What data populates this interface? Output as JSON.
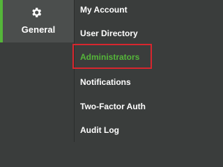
{
  "sidebar": {
    "active_item": {
      "label": "General",
      "icon": "gear-icon"
    }
  },
  "submenu": {
    "items": [
      {
        "label": "My Account"
      },
      {
        "label": "User Directory"
      },
      {
        "label": "Administrators",
        "active": true
      },
      {
        "label": "Notifications"
      },
      {
        "label": "Two-Factor Auth"
      },
      {
        "label": "Audit Log"
      }
    ]
  },
  "colors": {
    "accent": "#55b63a",
    "highlight_border": "#d7262e",
    "background": "#3a3d3c"
  }
}
